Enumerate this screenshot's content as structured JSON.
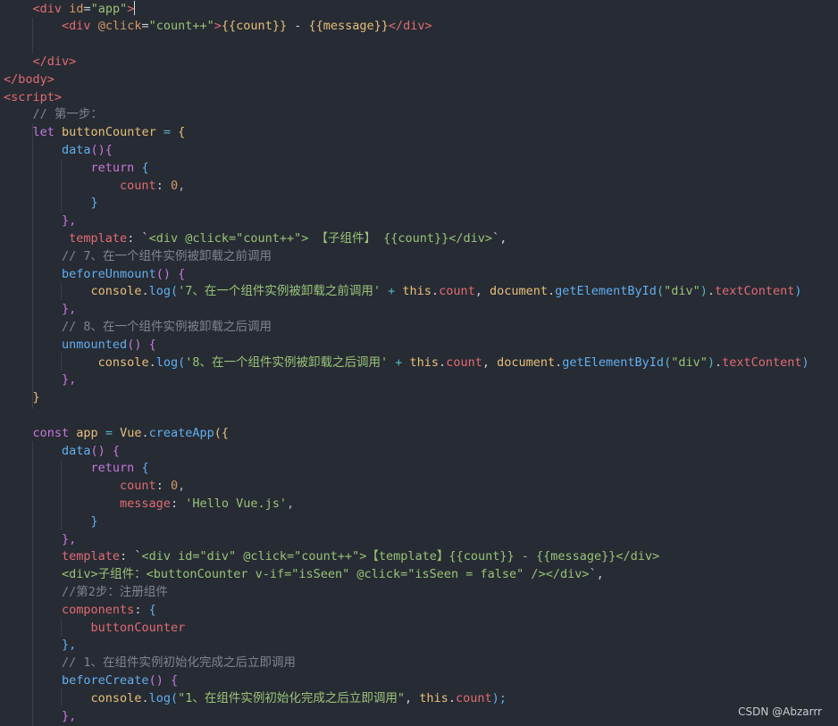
{
  "editor": {
    "language": "html",
    "lines": [
      [
        [
          "    ",
          "pl"
        ],
        [
          "<",
          "tag"
        ],
        [
          "div",
          "tag"
        ],
        [
          " ",
          "pl"
        ],
        [
          "id",
          "attr"
        ],
        [
          "=",
          "pl"
        ],
        [
          "\"app\"",
          "str"
        ],
        [
          ">",
          "tag"
        ]
      ],
      [
        [
          "        ",
          "pl"
        ],
        [
          "<",
          "tag"
        ],
        [
          "div",
          "tag"
        ],
        [
          " ",
          "pl"
        ],
        [
          "@click",
          "attr"
        ],
        [
          "=",
          "pl"
        ],
        [
          "\"count++\"",
          "str"
        ],
        [
          ">",
          "tag"
        ],
        [
          "{{count}}",
          "var"
        ],
        [
          " - ",
          "pl"
        ],
        [
          "{{message}}",
          "var"
        ],
        [
          "</",
          "tag"
        ],
        [
          "div",
          "tag"
        ],
        [
          ">",
          "tag"
        ]
      ],
      [],
      [
        [
          "    ",
          "pl"
        ],
        [
          "</",
          "tag"
        ],
        [
          "div",
          "tag"
        ],
        [
          ">",
          "tag"
        ]
      ],
      [
        [
          "</",
          "tag"
        ],
        [
          "body",
          "tag"
        ],
        [
          ">",
          "tag"
        ]
      ],
      [
        [
          "<",
          "tag"
        ],
        [
          "script",
          "tag"
        ],
        [
          ">",
          "tag"
        ]
      ],
      [
        [
          "    ",
          "pl"
        ],
        [
          "// 第一步：",
          "cm"
        ]
      ],
      [
        [
          "    ",
          "pl"
        ],
        [
          "let",
          "kw"
        ],
        [
          " ",
          "pl"
        ],
        [
          "buttonCounter",
          "var"
        ],
        [
          " = ",
          "op"
        ],
        [
          "{",
          "br1"
        ]
      ],
      [
        [
          "        ",
          "pl"
        ],
        [
          "data",
          "fn"
        ],
        [
          "(){",
          "br2"
        ]
      ],
      [
        [
          "            ",
          "pl"
        ],
        [
          "return",
          "kw"
        ],
        [
          " ",
          "pl"
        ],
        [
          "{",
          "br3"
        ]
      ],
      [
        [
          "                ",
          "pl"
        ],
        [
          "count",
          "prop"
        ],
        [
          ": ",
          "pl"
        ],
        [
          "0",
          "num"
        ],
        [
          ",",
          "pun"
        ]
      ],
      [
        [
          "            ",
          "pl"
        ],
        [
          "}",
          "br3"
        ]
      ],
      [
        [
          "        ",
          "pl"
        ],
        [
          "},",
          "br2"
        ]
      ],
      [
        [
          "         ",
          "pl"
        ],
        [
          "template",
          "prop"
        ],
        [
          ": `",
          "pl"
        ],
        [
          "<div @click=\"count++\"> 【子组件】 {{count}}</div>",
          "str"
        ],
        [
          "`,",
          "pl"
        ]
      ],
      [
        [
          "        ",
          "pl"
        ],
        [
          "// 7、在一个组件实例被卸载之前调用",
          "cm"
        ]
      ],
      [
        [
          "        ",
          "pl"
        ],
        [
          "beforeUnmount",
          "fn"
        ],
        [
          "() {",
          "br2"
        ]
      ],
      [
        [
          "            ",
          "pl"
        ],
        [
          "console",
          "var"
        ],
        [
          ".",
          "pl"
        ],
        [
          "log",
          "fn"
        ],
        [
          "(",
          "br3"
        ],
        [
          "'7、在一个组件实例被卸载之前调用'",
          "str"
        ],
        [
          " + ",
          "op"
        ],
        [
          "this",
          "var"
        ],
        [
          ".",
          "pl"
        ],
        [
          "count",
          "prop"
        ],
        [
          ", ",
          "pl"
        ],
        [
          "document",
          "var"
        ],
        [
          ".",
          "pl"
        ],
        [
          "getElementById",
          "fn"
        ],
        [
          "(",
          "br4"
        ],
        [
          "\"div\"",
          "str"
        ],
        [
          ")",
          "br4"
        ],
        [
          ".",
          "pl"
        ],
        [
          "textContent",
          "prop"
        ],
        [
          ")",
          "br3"
        ]
      ],
      [
        [
          "        ",
          "pl"
        ],
        [
          "},",
          "br2"
        ]
      ],
      [
        [
          "        ",
          "pl"
        ],
        [
          "// 8、在一个组件实例被卸载之后调用",
          "cm"
        ]
      ],
      [
        [
          "        ",
          "pl"
        ],
        [
          "unmounted",
          "fn"
        ],
        [
          "() {",
          "br2"
        ]
      ],
      [
        [
          "             ",
          "pl"
        ],
        [
          "console",
          "var"
        ],
        [
          ".",
          "pl"
        ],
        [
          "log",
          "fn"
        ],
        [
          "(",
          "br3"
        ],
        [
          "'8、在一个组件实例被卸载之后调用'",
          "str"
        ],
        [
          " + ",
          "op"
        ],
        [
          "this",
          "var"
        ],
        [
          ".",
          "pl"
        ],
        [
          "count",
          "prop"
        ],
        [
          ", ",
          "pl"
        ],
        [
          "document",
          "var"
        ],
        [
          ".",
          "pl"
        ],
        [
          "getElementById",
          "fn"
        ],
        [
          "(",
          "br4"
        ],
        [
          "\"div\"",
          "str"
        ],
        [
          ")",
          "br4"
        ],
        [
          ".",
          "pl"
        ],
        [
          "textContent",
          "prop"
        ],
        [
          ")",
          "br3"
        ]
      ],
      [
        [
          "        ",
          "pl"
        ],
        [
          "},",
          "br2"
        ]
      ],
      [
        [
          "    ",
          "pl"
        ],
        [
          "}",
          "br1"
        ]
      ],
      [],
      [
        [
          "    ",
          "pl"
        ],
        [
          "const",
          "kw"
        ],
        [
          " ",
          "pl"
        ],
        [
          "app",
          "var"
        ],
        [
          " = ",
          "op"
        ],
        [
          "Vue",
          "var"
        ],
        [
          ".",
          "pl"
        ],
        [
          "createApp",
          "fn"
        ],
        [
          "({",
          "br1"
        ]
      ],
      [
        [
          "        ",
          "pl"
        ],
        [
          "data",
          "fn"
        ],
        [
          "() {",
          "br2"
        ]
      ],
      [
        [
          "            ",
          "pl"
        ],
        [
          "return",
          "kw"
        ],
        [
          " ",
          "pl"
        ],
        [
          "{",
          "br3"
        ]
      ],
      [
        [
          "                ",
          "pl"
        ],
        [
          "count",
          "prop"
        ],
        [
          ": ",
          "pl"
        ],
        [
          "0",
          "num"
        ],
        [
          ",",
          "pun"
        ]
      ],
      [
        [
          "                ",
          "pl"
        ],
        [
          "message",
          "prop"
        ],
        [
          ": ",
          "pl"
        ],
        [
          "'Hello Vue.js'",
          "str"
        ],
        [
          ",",
          "pun"
        ]
      ],
      [
        [
          "            ",
          "pl"
        ],
        [
          "}",
          "br3"
        ]
      ],
      [
        [
          "        ",
          "pl"
        ],
        [
          "},",
          "br2"
        ]
      ],
      [
        [
          "        ",
          "pl"
        ],
        [
          "template",
          "prop"
        ],
        [
          ": `",
          "pl"
        ],
        [
          "<div id=\"div\" @click=\"count++\">【template】{{count}} - {{message}}</div>",
          "str"
        ]
      ],
      [
        [
          "        ",
          "pl"
        ],
        [
          "<div>子组件：<buttonCounter v-if=\"isSeen\" @click=\"isSeen = false\" /></div>",
          "str"
        ],
        [
          "`,",
          "pl"
        ]
      ],
      [
        [
          "        ",
          "pl"
        ],
        [
          "//第2步：注册组件",
          "cm"
        ]
      ],
      [
        [
          "        ",
          "pl"
        ],
        [
          "components",
          "prop"
        ],
        [
          ": ",
          "pl"
        ],
        [
          "{",
          "br3"
        ]
      ],
      [
        [
          "            ",
          "pl"
        ],
        [
          "buttonCounter",
          "prop"
        ]
      ],
      [
        [
          "        ",
          "pl"
        ],
        [
          "},",
          "br3"
        ]
      ],
      [
        [
          "        ",
          "pl"
        ],
        [
          "// 1、在组件实例初始化完成之后立即调用",
          "cm"
        ]
      ],
      [
        [
          "        ",
          "pl"
        ],
        [
          "beforeCreate",
          "fn"
        ],
        [
          "() {",
          "br2"
        ]
      ],
      [
        [
          "            ",
          "pl"
        ],
        [
          "console",
          "var"
        ],
        [
          ".",
          "pl"
        ],
        [
          "log",
          "fn"
        ],
        [
          "(",
          "br3"
        ],
        [
          "\"1、在组件实例初始化完成之后立即调用\"",
          "str"
        ],
        [
          ", ",
          "pl"
        ],
        [
          "this",
          "var"
        ],
        [
          ".",
          "pl"
        ],
        [
          "count",
          "prop"
        ],
        [
          ");",
          "br3"
        ]
      ],
      [
        [
          "        ",
          "pl"
        ],
        [
          "},",
          "br2"
        ]
      ]
    ]
  },
  "watermark": "CSDN @Abzarrr"
}
